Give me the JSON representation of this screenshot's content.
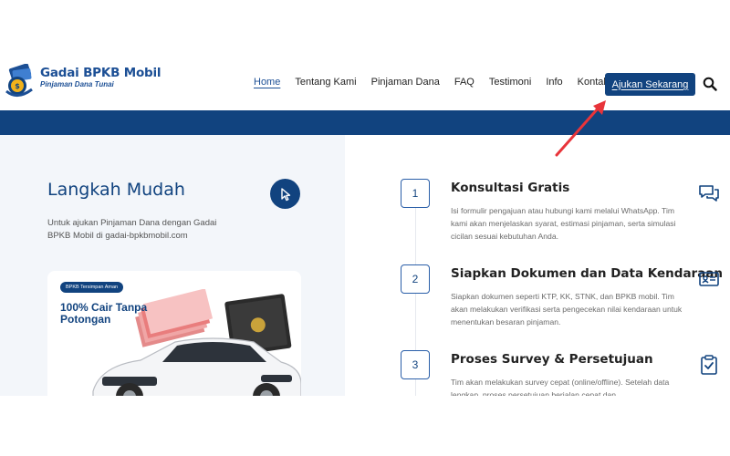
{
  "brand": {
    "name": "Gadai BPKB Mobil",
    "tagline": "Pinjaman Dana Tunai"
  },
  "nav": {
    "items": [
      {
        "label": "Home",
        "active": true
      },
      {
        "label": "Tentang Kami",
        "active": false
      },
      {
        "label": "Pinjaman Dana",
        "active": false
      },
      {
        "label": "FAQ",
        "active": false
      },
      {
        "label": "Testimoni",
        "active": false
      },
      {
        "label": "Info",
        "active": false
      },
      {
        "label": "Kontak",
        "active": false
      }
    ],
    "cta_label": "Ajukan Sekarang",
    "search_icon": "search-icon"
  },
  "colors": {
    "primary": "#11437f",
    "accent_arrow": "#e8343a",
    "panel_bg": "#f3f6fa"
  },
  "intro": {
    "title": "Langkah Mudah",
    "description": "Untuk ajukan Pinjaman Dana dengan Gadai BPKB Mobil di gadai-bpkbmobil.com",
    "promo_badge": "BPKB Tersimpan Aman",
    "promo_headline": "100% Cair Tanpa Potongan"
  },
  "steps": [
    {
      "number": "1",
      "title": "Konsultasi Gratis",
      "text": "Isi formulir pengajuan atau hubungi kami melalui WhatsApp. Tim kami akan menjelaskan syarat, estimasi pinjaman, serta simulasi cicilan sesuai kebutuhan Anda.",
      "icon": "chat-icon"
    },
    {
      "number": "2",
      "title": "Siapkan Dokumen dan Data Kendaraan",
      "text": "Siapkan dokumen seperti KTP, KK, STNK, dan BPKB mobil. Tim akan melakukan verifikasi serta pengecekan nilai kendaraan untuk menentukan besaran pinjaman.",
      "icon": "id-card-icon"
    },
    {
      "number": "3",
      "title": "Proses Survey & Persetujuan",
      "text": "Tim akan melakukan survey cepat (online/offline). Setelah data lengkap, proses persetujuan berjalan cepat dan",
      "icon": "clipboard-check-icon"
    }
  ]
}
